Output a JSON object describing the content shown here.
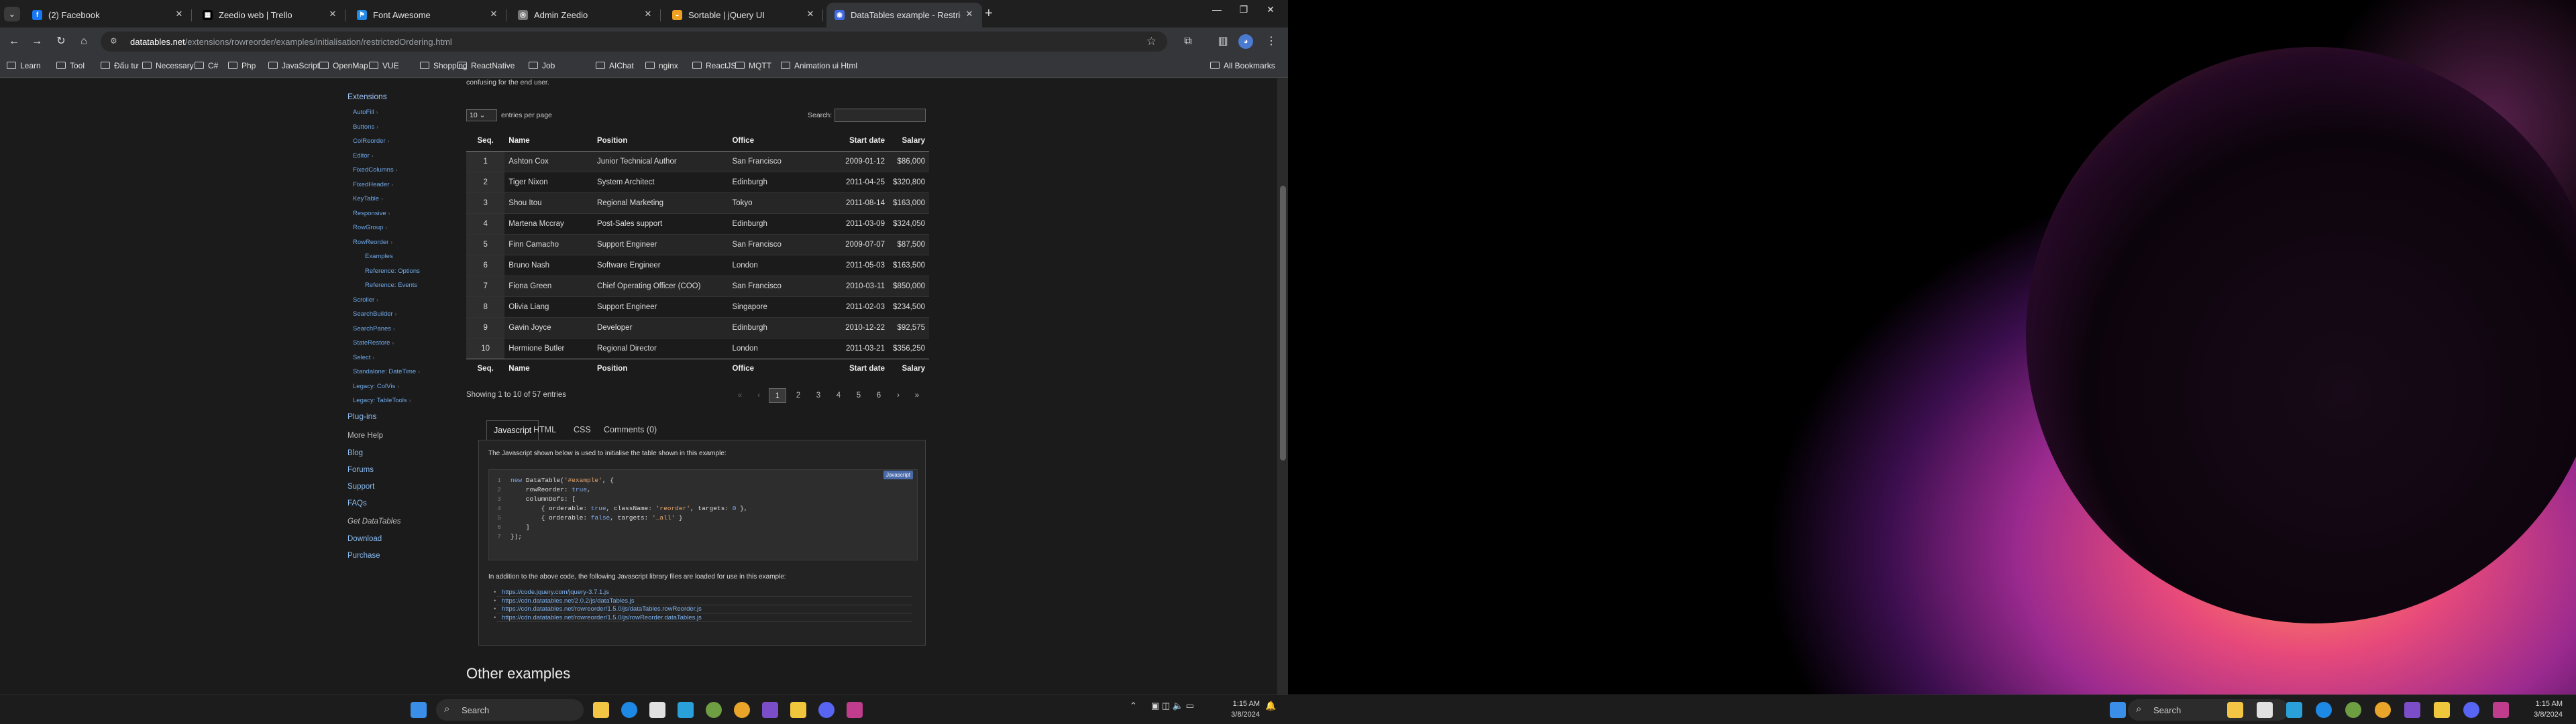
{
  "browser": {
    "tabs": [
      {
        "title": "(2) Facebook",
        "favicon_color": "#1877f2",
        "favicon_text": "f"
      },
      {
        "title": "Zeedio web | Trello",
        "favicon_color": "#000000",
        "favicon_text": "▦"
      },
      {
        "title": "Font Awesome",
        "favicon_color": "#228ae6",
        "favicon_text": "⚑"
      },
      {
        "title": "Admin Zeedio",
        "favicon_color": "#777777",
        "favicon_text": "◎"
      },
      {
        "title": "Sortable | jQuery UI",
        "favicon_color": "#f0a020",
        "favicon_text": "◒"
      },
      {
        "title": "DataTables example - Restrict...",
        "favicon_color": "#4169e1",
        "favicon_text": "◉",
        "active": true
      }
    ],
    "url_host": "datatables.net",
    "url_path": "/extensions/rowreorder/examples/initialisation/restrictedOrdering.html",
    "bookmarks": [
      "Learn",
      "Tool",
      "Đấu tư",
      "Necessary",
      "C#",
      "Php",
      "JavaScript",
      "OpenMap",
      "VUE",
      "Shopping",
      "ReactNative",
      "Job",
      "AIChat",
      "nginx",
      "ReactJS",
      "MQTT",
      "Animation ui Html"
    ],
    "all_bookmarks": "All Bookmarks"
  },
  "sidebar": {
    "section": "Extensions",
    "items": [
      {
        "label": "AutoFill"
      },
      {
        "label": "Buttons"
      },
      {
        "label": "ColReorder"
      },
      {
        "label": "Editor"
      },
      {
        "label": "FixedColumns"
      },
      {
        "label": "FixedHeader"
      },
      {
        "label": "KeyTable"
      },
      {
        "label": "Responsive"
      },
      {
        "label": "RowGroup"
      },
      {
        "label": "RowReorder"
      }
    ],
    "rowreorder_children": [
      "Examples",
      "Reference: Options",
      "Reference: Events"
    ],
    "items2": [
      {
        "label": "Scroller"
      },
      {
        "label": "SearchBuilder"
      },
      {
        "label": "SearchPanes"
      },
      {
        "label": "StateRestore"
      },
      {
        "label": "Select"
      },
      {
        "label": "Standalone: DateTime"
      },
      {
        "label": "Legacy: ColVis"
      },
      {
        "label": "Legacy: TableTools"
      }
    ],
    "plugins": "Plug-ins",
    "more_help": "More Help",
    "help_links": [
      "Blog",
      "Forums",
      "Support",
      "FAQs"
    ],
    "get": "Get DataTables",
    "get_links": [
      "Download",
      "Purchase"
    ]
  },
  "main": {
    "intro_tail": "confusing for the end user.",
    "length_value": "10",
    "length_text": "entries per page",
    "search_label": "Search:",
    "columns": [
      "Seq.",
      "Name",
      "Position",
      "Office",
      "Start date",
      "Salary"
    ],
    "rows": [
      [
        "1",
        "Ashton Cox",
        "Junior Technical Author",
        "San Francisco",
        "2009-01-12",
        "$86,000"
      ],
      [
        "2",
        "Tiger Nixon",
        "System Architect",
        "Edinburgh",
        "2011-04-25",
        "$320,800"
      ],
      [
        "3",
        "Shou Itou",
        "Regional Marketing",
        "Tokyo",
        "2011-08-14",
        "$163,000"
      ],
      [
        "4",
        "Martena Mccray",
        "Post-Sales support",
        "Edinburgh",
        "2011-03-09",
        "$324,050"
      ],
      [
        "5",
        "Finn Camacho",
        "Support Engineer",
        "San Francisco",
        "2009-07-07",
        "$87,500"
      ],
      [
        "6",
        "Bruno Nash",
        "Software Engineer",
        "London",
        "2011-05-03",
        "$163,500"
      ],
      [
        "7",
        "Fiona Green",
        "Chief Operating Officer (COO)",
        "San Francisco",
        "2010-03-11",
        "$850,000"
      ],
      [
        "8",
        "Olivia Liang",
        "Support Engineer",
        "Singapore",
        "2011-02-03",
        "$234,500"
      ],
      [
        "9",
        "Gavin Joyce",
        "Developer",
        "Edinburgh",
        "2010-12-22",
        "$92,575"
      ],
      [
        "10",
        "Hermione Butler",
        "Regional Director",
        "London",
        "2011-03-21",
        "$356,250"
      ]
    ],
    "info": "Showing 1 to 10 of 57 entries",
    "pages": [
      "«",
      "‹",
      "1",
      "2",
      "3",
      "4",
      "5",
      "6",
      "›",
      "»"
    ],
    "code_tabs": [
      "Javascript",
      "HTML",
      "CSS",
      "Comments (0)"
    ],
    "code_intro": "The Javascript shown below is used to initialise the table shown in this example:",
    "code_badge": "Javascript",
    "code_note": "In addition to the above code, the following Javascript library files are loaded for use in this example:",
    "libs": [
      "https://code.jquery.com/jquery-3.7.1.js",
      "https://cdn.datatables.net/2.0.2/js/dataTables.js",
      "https://cdn.datatables.net/rowreorder/1.5.0/js/dataTables.rowReorder.js",
      "https://cdn.datatables.net/rowreorder/1.5.0/js/rowReorder.dataTables.js"
    ],
    "other_examples": "Other examples"
  },
  "taskbar": {
    "search": "Search",
    "time": "1:15 AM",
    "date": "3/8/2024"
  },
  "colors": {
    "link": "#8bbcf0",
    "accent_blue": "#4a6aa8"
  }
}
